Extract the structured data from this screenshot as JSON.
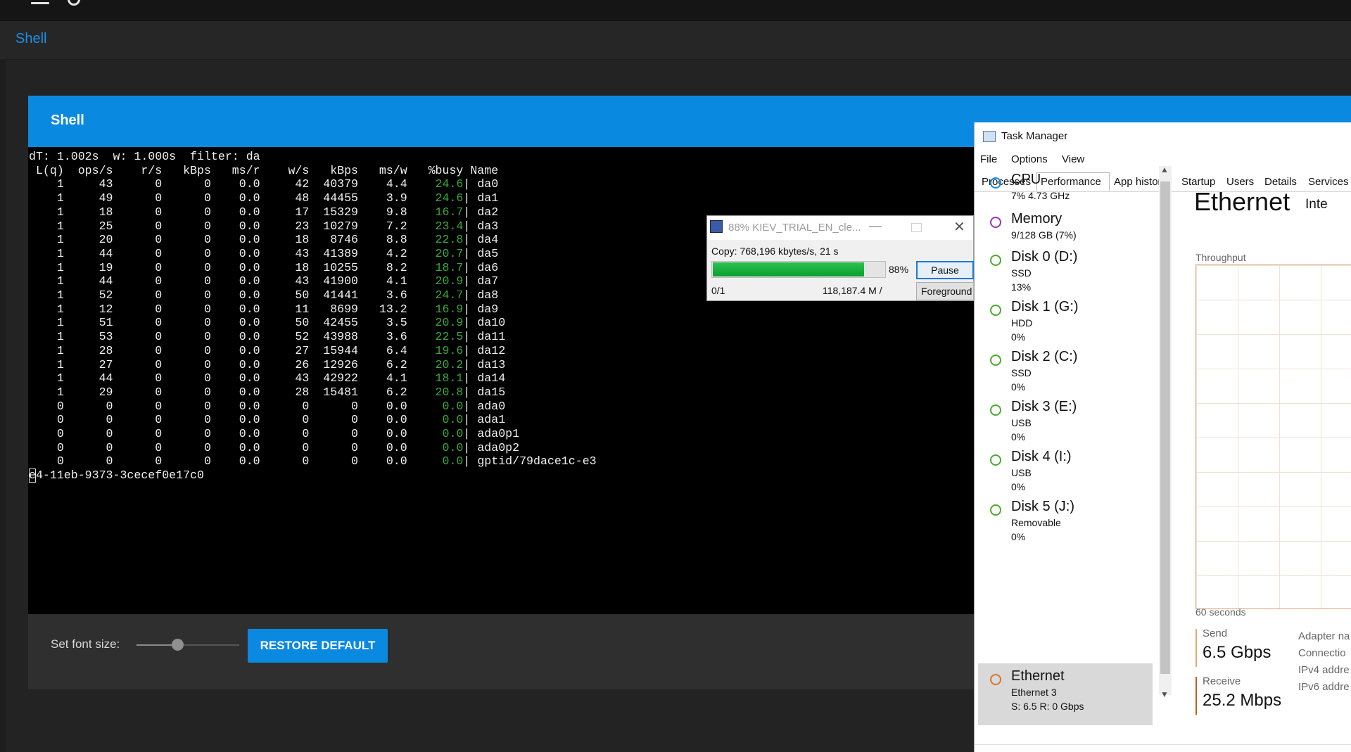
{
  "app": {
    "breadcrumb": "Shell",
    "header_title": "Shell"
  },
  "terminal": {
    "lines": [
      "dT: 1.002s  w: 1.000s  filter: da",
      " L(q)  ops/s    r/s   kBps   ms/r    w/s   kBps   ms/w   %busy Name"
    ],
    "rows": [
      [
        "1",
        "43",
        "0",
        "0",
        "0.0",
        "42",
        "40379",
        "4.4",
        "24.6",
        "da0"
      ],
      [
        "1",
        "49",
        "0",
        "0",
        "0.0",
        "48",
        "44455",
        "3.9",
        "24.6",
        "da1"
      ],
      [
        "1",
        "18",
        "0",
        "0",
        "0.0",
        "17",
        "15329",
        "9.8",
        "16.7",
        "da2"
      ],
      [
        "1",
        "25",
        "0",
        "0",
        "0.0",
        "23",
        "10279",
        "7.2",
        "23.4",
        "da3"
      ],
      [
        "1",
        "20",
        "0",
        "0",
        "0.0",
        "18",
        "8746",
        "8.8",
        "22.8",
        "da4"
      ],
      [
        "1",
        "44",
        "0",
        "0",
        "0.0",
        "43",
        "41389",
        "4.2",
        "20.7",
        "da5"
      ],
      [
        "1",
        "19",
        "0",
        "0",
        "0.0",
        "18",
        "10255",
        "8.2",
        "18.7",
        "da6"
      ],
      [
        "1",
        "44",
        "0",
        "0",
        "0.0",
        "43",
        "41900",
        "4.1",
        "20.9",
        "da7"
      ],
      [
        "1",
        "52",
        "0",
        "0",
        "0.0",
        "50",
        "41441",
        "3.6",
        "24.7",
        "da8"
      ],
      [
        "1",
        "12",
        "0",
        "0",
        "0.0",
        "11",
        "8699",
        "13.2",
        "16.9",
        "da9"
      ],
      [
        "1",
        "51",
        "0",
        "0",
        "0.0",
        "50",
        "42455",
        "3.5",
        "20.9",
        "da10"
      ],
      [
        "1",
        "53",
        "0",
        "0",
        "0.0",
        "52",
        "43988",
        "3.6",
        "22.5",
        "da11"
      ],
      [
        "1",
        "28",
        "0",
        "0",
        "0.0",
        "27",
        "15944",
        "6.4",
        "19.6",
        "da12"
      ],
      [
        "1",
        "27",
        "0",
        "0",
        "0.0",
        "26",
        "12926",
        "6.2",
        "20.2",
        "da13"
      ],
      [
        "1",
        "44",
        "0",
        "0",
        "0.0",
        "43",
        "42922",
        "4.1",
        "18.1",
        "da14"
      ],
      [
        "1",
        "29",
        "0",
        "0",
        "0.0",
        "28",
        "15481",
        "6.2",
        "20.8",
        "da15"
      ],
      [
        "0",
        "0",
        "0",
        "0",
        "0.0",
        "0",
        "0",
        "0.0",
        "0.0",
        "ada0"
      ],
      [
        "0",
        "0",
        "0",
        "0",
        "0.0",
        "0",
        "0",
        "0.0",
        "0.0",
        "ada1"
      ],
      [
        "0",
        "0",
        "0",
        "0",
        "0.0",
        "0",
        "0",
        "0.0",
        "0.0",
        "ada0p1"
      ],
      [
        "0",
        "0",
        "0",
        "0",
        "0.0",
        "0",
        "0",
        "0.0",
        "0.0",
        "ada0p2"
      ],
      [
        "0",
        "0",
        "0",
        "0",
        "0.0",
        "0",
        "0",
        "0.0",
        "0.0",
        "gptid/79dace1c-e3"
      ]
    ],
    "cursor_char": "e",
    "cursor_line_rest": "4-11eb-9373-3cecef0e17c0"
  },
  "font_control": {
    "label": "Set font size:",
    "slider_value_fraction": 0.4,
    "restore_label": "RESTORE DEFAULT"
  },
  "copy_dialog": {
    "title": "88% KIEV_TRIAL_EN_cle...",
    "status": "Copy: 768,196 kbytes/s, 21 s",
    "progress_percent": 88,
    "progress_label": "88%",
    "pause_label": "Pause",
    "count": "0/1",
    "size": "118,187.4 M /",
    "foreground_label": "Foreground",
    "min_glyph": "—",
    "close_glyph": "✕"
  },
  "task_manager": {
    "title": "Task Manager",
    "menu": [
      "File",
      "Options",
      "View"
    ],
    "tabs": [
      "Processes",
      "Performance",
      "App history",
      "Startup",
      "Users",
      "Details",
      "Services"
    ],
    "sidebar": [
      {
        "title": "CPU",
        "sub1": "7% 4.73 GHz",
        "sub2": "",
        "color": "#1a8ad4"
      },
      {
        "title": "Memory",
        "sub1": "9/128 GB (7%)",
        "sub2": "",
        "color": "#9a35b8"
      },
      {
        "title": "Disk 0 (D:)",
        "sub1": "SSD",
        "sub2": "13%",
        "color": "#4caa2e"
      },
      {
        "title": "Disk 1 (G:)",
        "sub1": "HDD",
        "sub2": "0%",
        "color": "#4caa2e"
      },
      {
        "title": "Disk 2 (C:)",
        "sub1": "SSD",
        "sub2": "0%",
        "color": "#4caa2e"
      },
      {
        "title": "Disk 3 (E:)",
        "sub1": "USB",
        "sub2": "0%",
        "color": "#4caa2e"
      },
      {
        "title": "Disk 4 (I:)",
        "sub1": "USB",
        "sub2": "0%",
        "color": "#4caa2e"
      },
      {
        "title": "Disk 5 (J:)",
        "sub1": "Removable",
        "sub2": "0%",
        "color": "#4caa2e"
      },
      {
        "title": "Ethernet",
        "sub1": "Ethernet 3",
        "sub2": "S: 6.5 R: 0 Gbps",
        "color": "#d2772c"
      }
    ],
    "detail": {
      "heading": "Ethernet",
      "heading_right": "Inte",
      "throughput_label": "Throughput",
      "time_label": "60 seconds",
      "send_label": "Send",
      "send_value": "6.5 Gbps",
      "receive_label": "Receive",
      "receive_value": "25.2 Mbps",
      "props": [
        "Adapter na",
        "Connectio",
        "IPv4 addre",
        "IPv6 addre"
      ]
    }
  }
}
